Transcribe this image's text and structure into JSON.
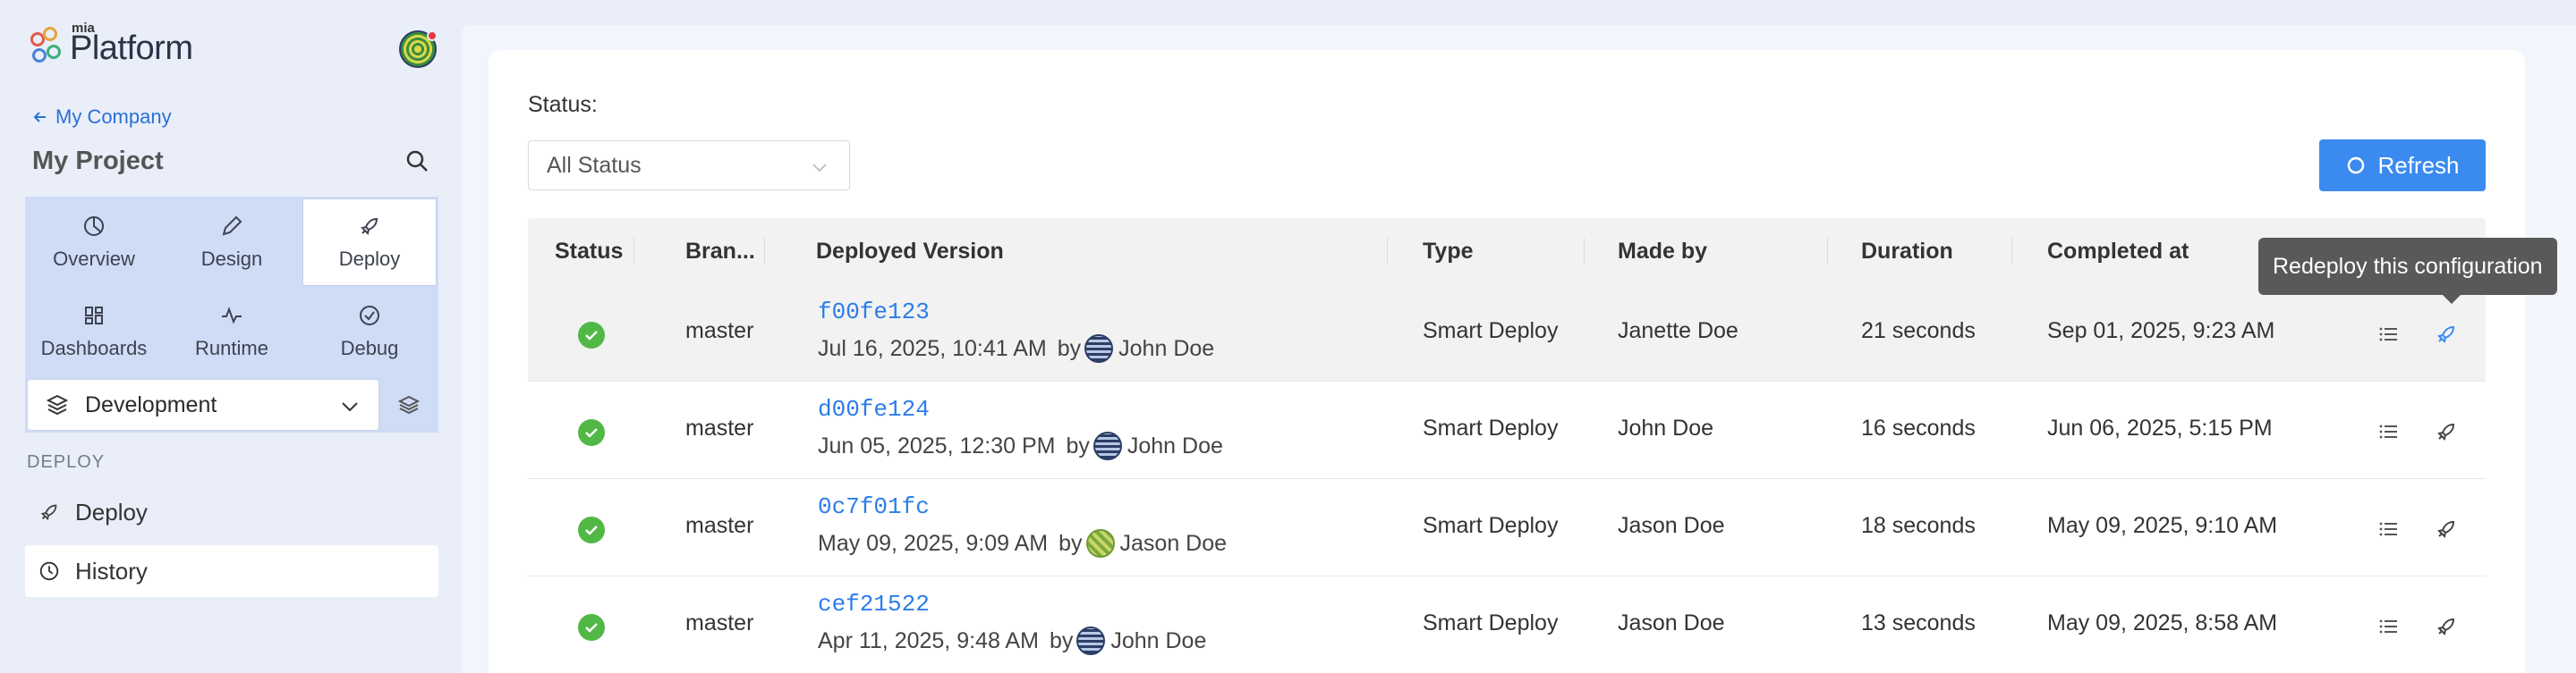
{
  "sidebar": {
    "logo_small": "mia",
    "logo_big": "Platform",
    "back_link": "My Company",
    "project_title": "My Project",
    "nav_tiles": [
      {
        "label": "Overview",
        "icon": "overview-icon"
      },
      {
        "label": "Design",
        "icon": "pencil-icon"
      },
      {
        "label": "Deploy",
        "icon": "rocket-icon",
        "active": true
      },
      {
        "label": "Dashboards",
        "icon": "dashboard-icon"
      },
      {
        "label": "Runtime",
        "icon": "pulse-icon"
      },
      {
        "label": "Debug",
        "icon": "check-circle-icon"
      }
    ],
    "environment": "Development",
    "section_label": "DEPLOY",
    "items": [
      {
        "label": "Deploy",
        "icon": "rocket-icon"
      },
      {
        "label": "History",
        "icon": "clock-icon",
        "active": true
      }
    ]
  },
  "filters": {
    "status_label": "Status:",
    "status_value": "All Status"
  },
  "toolbar": {
    "refresh_label": "Refresh"
  },
  "table": {
    "headers": [
      "Status",
      "Bran...",
      "Deployed Version",
      "Type",
      "Made by",
      "Duration",
      "Completed at"
    ],
    "rows": [
      {
        "branch": "master",
        "commit": "f00fe123",
        "date": "Jul 16, 2025, 10:41 AM",
        "by": "by",
        "author": "John Doe",
        "type": "Smart Deploy",
        "made_by": "Janette Doe",
        "duration": "21 seconds",
        "completed": "Sep 01, 2025, 9:23 AM"
      },
      {
        "branch": "master",
        "commit": "d00fe124",
        "date": "Jun 05, 2025, 12:30 PM",
        "by": "by",
        "author": "John Doe",
        "type": "Smart Deploy",
        "made_by": "John Doe",
        "duration": "16 seconds",
        "completed": "Jun 06, 2025, 5:15 PM"
      },
      {
        "branch": "master",
        "commit": "0c7f01fc",
        "date": "May 09, 2025, 9:09 AM",
        "by": "by",
        "author": "Jason Doe",
        "type": "Smart Deploy",
        "made_by": "Jason Doe",
        "duration": "18 seconds",
        "completed": "May 09, 2025, 9:10 AM"
      },
      {
        "branch": "master",
        "commit": "cef21522",
        "date": "Apr 11, 2025, 9:48 AM",
        "by": "by",
        "author": "John Doe",
        "type": "Smart Deploy",
        "made_by": "Jason Doe",
        "duration": "13 seconds",
        "completed": "May 09, 2025, 8:58 AM"
      }
    ]
  },
  "tooltip": "Redeploy this configuration",
  "colors": {
    "accent": "#3a8af0",
    "link": "#2b7de9",
    "success": "#52b845",
    "sidebar_bg": "#e9eef8",
    "nav_bg": "#cfdcf5"
  }
}
